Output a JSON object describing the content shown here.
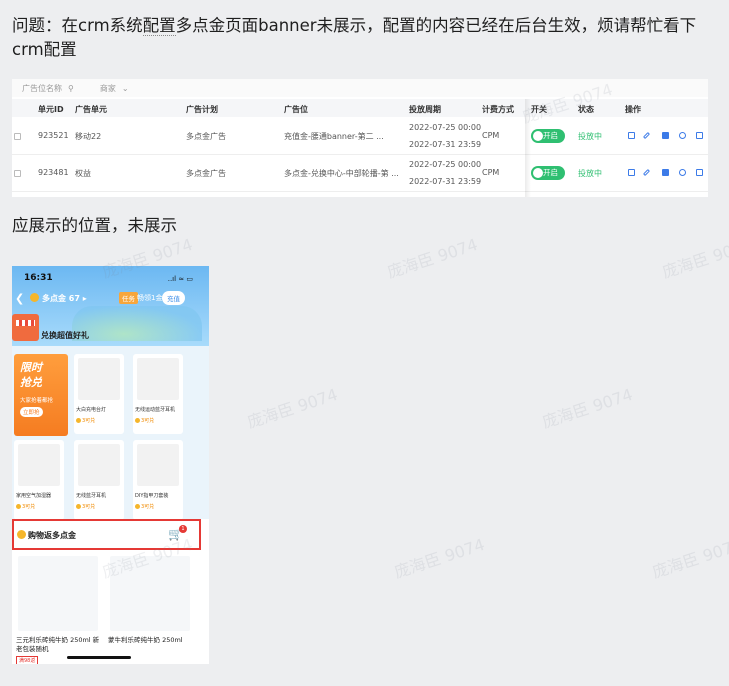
{
  "question": {
    "label": "问题：",
    "text_before": "在crm系统",
    "text_dotted": "配置",
    "text_after": "多点金页面banner未展示，配置的内容已经在后台生效，烦请帮忙看下crm配置"
  },
  "crm": {
    "filter": {
      "field": "广告位名称",
      "merchant": "商家"
    },
    "columns": [
      "单元ID",
      "广告单元",
      "广告计划",
      "广告位",
      "投放周期",
      "计费方式",
      "开关",
      "状态",
      "操作"
    ],
    "rows": [
      {
        "id": "923521",
        "unit": "移动22",
        "plan": "多点金广告",
        "slot": "充值金-腰通banner-第二 ...",
        "start": "2022-07-25 00:00",
        "end": "2022-07-31 23:59",
        "billing": "CPM",
        "switch": "开启",
        "status": "投放中"
      },
      {
        "id": "923481",
        "unit": "权益",
        "plan": "多点金广告",
        "slot": "多点金-兑换中心-中部轮播-第 ...",
        "start": "2022-07-25 00:00",
        "end": "2022-07-31 23:59",
        "billing": "CPM",
        "switch": "开启",
        "status": "投放中"
      }
    ],
    "actions": [
      "copy-icon",
      "edit-icon",
      "stats-icon",
      "view-icon",
      "file-icon"
    ],
    "accent": "#2fbf71"
  },
  "section_label": "应展示的位置，未展示",
  "phone": {
    "time": "16:31",
    "signal": "..ıl ≈ ▭",
    "points_label": "多点金",
    "points_value": "67",
    "task_badge": "任务",
    "daily_label": "畅领1金",
    "recharge": "充值",
    "section_title": "兑换超值好礼",
    "promo_title_1": "限时",
    "promo_title_2": "抢兑",
    "promo_sub": "大家抢着都抢",
    "promo_btn": "立即抢",
    "cards": [
      {
        "name": "大白充电台灯",
        "price": "3可兑"
      },
      {
        "name": "无线运动蓝牙耳机",
        "price": "3可兑"
      },
      {
        "name": "家用空气加湿器",
        "price": "3可兑"
      },
      {
        "name": "无线蓝牙耳机",
        "price": "3可兑"
      },
      {
        "name": "DIY指甲刀套装",
        "price": "3可兑"
      }
    ],
    "redbox_title": "购物返多点金",
    "cart_badge": "1",
    "products": [
      {
        "name": "三元利乐砖纯牛奶 250ml 新老包装随机",
        "tag": "满98返"
      },
      {
        "name": "蒙牛利乐砖纯牛奶 250ml",
        "tag": ""
      }
    ]
  },
  "watermark": "庞海臣 9074"
}
